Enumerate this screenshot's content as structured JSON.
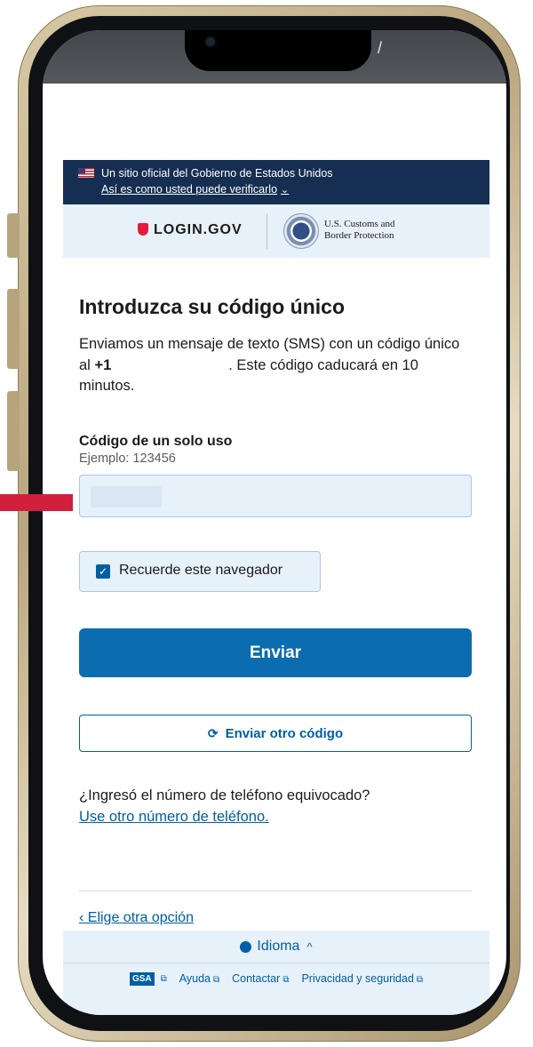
{
  "gov_banner": {
    "official_text": "Un sitio oficial del Gobierno de Estados Unidos",
    "verify_link": "Así es como usted puede verificarlo"
  },
  "brand": {
    "logo_text": "LOGIN.GOV",
    "partner_line1": "U.S. Customs and",
    "partner_line2": "Border Protection"
  },
  "page": {
    "title": "Introduzca su código único",
    "intro_prefix": "Enviamos un mensaje de texto (SMS) con un código único al ",
    "intro_country_code": "+1",
    "intro_suffix": ". Este código caducará en 10 minutos."
  },
  "otp_field": {
    "label": "Código de un solo uso",
    "hint": "Ejemplo: 123456",
    "value": ""
  },
  "remember_browser": {
    "label": "Recuerde este navegador",
    "checked": true
  },
  "actions": {
    "submit_label": "Enviar",
    "resend_label": "Enviar otro código"
  },
  "wrong_number": {
    "question": "¿Ingresó el número de teléfono equivocado?",
    "link": "Use otro número de teléfono."
  },
  "back": {
    "link": "‹ Elige otra opción"
  },
  "footer": {
    "language_label": "Idioma",
    "gsa_badge": "GSA",
    "links": [
      "Ayuda",
      "Contactar",
      "Privacidad y seguridad"
    ]
  },
  "colors": {
    "primary": "#005ea2",
    "banner_bg": "#162e51",
    "light_bg": "#e7f1fa"
  }
}
